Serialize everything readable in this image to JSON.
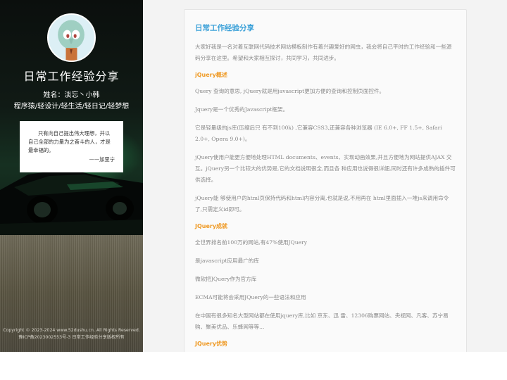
{
  "sidebar": {
    "site_name": "日常工作经验分享",
    "author": "姓名：淡忘丶小韩",
    "tagline": "程序猿/轻设计/轻生活/轻日记/轻梦想",
    "quote": {
      "text": "只有向自己提出伟大理想，并以自己全部的力量为之奋斗的人，才是最幸福的。",
      "source": "——加里宁"
    },
    "copyright_line1": "Copyright © 2023-2024 www.52dushu.cn. All Rights Reserved.",
    "copyright_line2": "豫ICP备2023002553号-3 日常工作经验分享版权所有"
  },
  "article": {
    "title": "日常工作经验分享",
    "intro": "大家好我是一名对着互联网代码技术网站模板制作有着兴趣爱好的网虫，我会将自己平时的工作经验和一些源码分享在这里。希望和大家相互探讨，共同学习，共同进步。",
    "sections": [
      {
        "heading": "jQuery概述",
        "paragraphs": [
          "Query 查询的意思, jQuery就是用javascript更加方便的查询和控制页面控件。",
          "Jquery是一个优秀的Javascript框架。",
          "它是轻量级的js库(压缩后只 有不到100k) ,它兼容CSS3,还兼容各种浏览器 (IE 6.0+, FF 1.5+, Safari 2.0+, Opera 9.0+)。",
          "jQuery使用户能更方便地处理HTML documents、events、实现动画效果,并且方便地为网站提供AJAX 交互。jQuery另一个比较大的优势是,它的文档说明很全,而且各 种应用也说得很详细,同时还有许多成熟的插件可供选择。",
          "jQuery能 够使用户的html页保持代码和html内容分离,也就是说,不用再在 html里面插入一堆js来调用命令了,只需定义id即可。"
        ]
      },
      {
        "heading": "JQuery成就",
        "paragraphs": [
          "全世界排名前100万的网站,有47%使用JQuery",
          "是javascript应用最广的库",
          "微软把JQuery作为官方库",
          "ECMA可能将会采用JQuery的一些语法和应用",
          "在中国有很多知名大型网站都在使用jquery库,比如 京东、迅 雷、12306购票网站、央视网、凡客、苏宁易购、聚美优品、乐蜂网等等..."
        ]
      },
      {
        "heading": "JQuery优势",
        "paragraphs": []
      }
    ]
  },
  "colors": {
    "title_blue": "#3aa0d8",
    "heading_orange": "#ef9a25",
    "body_gray": "#888888"
  },
  "icons": {
    "avatar": "squidward-avatar-icon"
  }
}
